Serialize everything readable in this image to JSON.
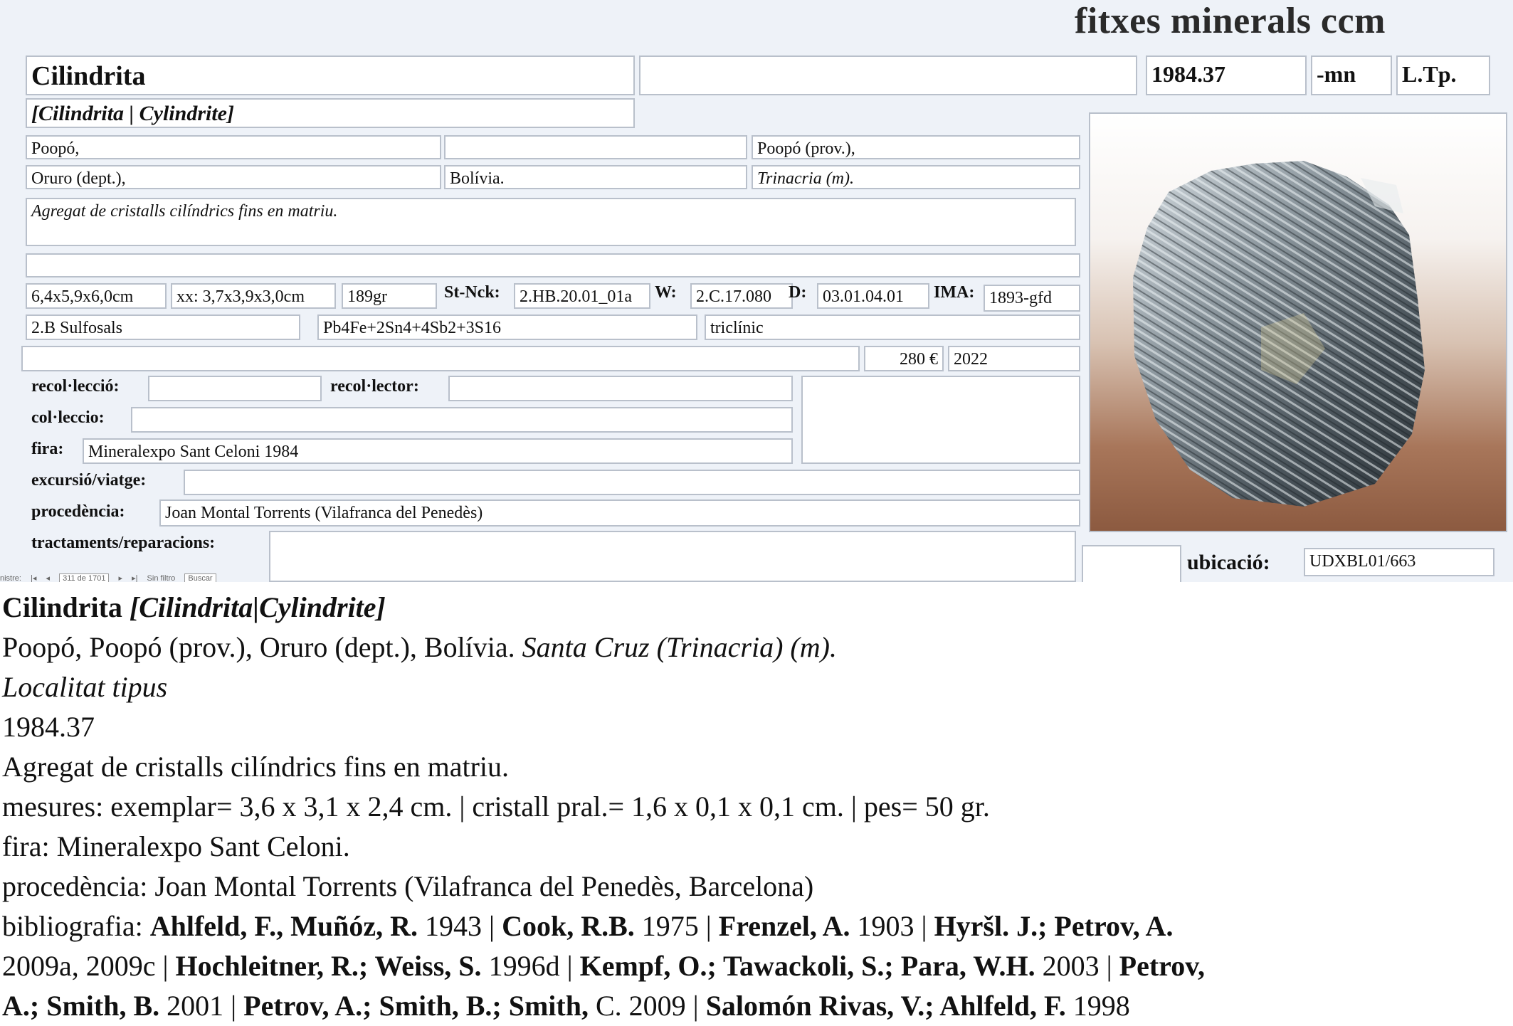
{
  "form": {
    "app_title": "fitxes minerals ccm",
    "name": "Cilindrita",
    "name_extra": "",
    "catalog_number": "1984.37",
    "suffix": "-mn",
    "type_locality_flag": "L.Tp.",
    "synonyms": "[Cilindrita | Cylindrite]",
    "locality_1": "Poopó,",
    "locality_2": "",
    "locality_3": "Poopó (prov.),",
    "locality_4": "Oruro (dept.),",
    "locality_5": "Bolívia.",
    "locality_6": "Trinacria (m).",
    "description": "Agregat de cristalls cilíndrics fins en matriu.",
    "notes": "",
    "size": "6,4x5,9x6,0cm",
    "crystal_size": "xx: 3,7x3,9x3,0cm",
    "weight": "189gr",
    "strunz_label": "St-Nck:",
    "strunz_value": "2.HB.20.01_01a",
    "w_label": "W:",
    "w_value": "2.C.17.080",
    "d_label": "D:",
    "d_value": "03.01.04.01",
    "ima_label": "IMA:",
    "ima_value": "1893-gfd",
    "class": "2.B Sulfosals",
    "formula": "Pb4Fe+2Sn4+4Sb2+3S16",
    "crystal_system": "triclínic",
    "blank_row": "",
    "price": "280 €",
    "year": "2022",
    "recoleccio_label": "recol·lecció:",
    "recoleccio_value": "",
    "recolector_label": "recol·lector:",
    "recolector_value": "",
    "coleccio_label": "col·leccio:",
    "coleccio_value": "",
    "fira_label": "fira:",
    "fira_value": "Mineralexpo Sant Celoni 1984",
    "excursio_label": "excursió/viatge:",
    "excursio_value": "",
    "procedencia_label": "procedència:",
    "procedencia_value": "Joan Montal Torrents (Vilafranca del Penedès)",
    "tractaments_label": "tractaments/reparacions:",
    "tractaments_value": "",
    "ubicacio_label": "ubicació:",
    "ubicacio_value": "UDXBL01/663"
  },
  "navigator": {
    "record_label": "nistre:",
    "record_position": "311 de 1701",
    "filter_label": "Sin filtro",
    "search_label": "Buscar"
  },
  "text": {
    "name": "Cilindrita",
    "synonyms": "[Cilindrita|Cylindrite]",
    "locality": "Poopó, Poopó (prov.), Oruro (dept.), Bolívia.",
    "mine": "Santa Cruz (Trinacria) (m).",
    "type_locality": "Localitat tipus",
    "catalog_number": "1984.37",
    "description": "Agregat de cristalls cilíndrics fins en matriu.",
    "measures": "mesures: exemplar= 3,6 x 3,1 x 2,4 cm. | cristall pral.= 1,6 x 0,1 x 0,1 cm. | pes= 50 gr.",
    "fair": "fira: Mineralexpo Sant Celoni.",
    "provenance": "procedència: Joan Montal Torrents (Vilafranca del Penedès, Barcelona)",
    "biblio_label": "bibliografia:",
    "biblio": [
      {
        "a": "Ahlfeld, F., Muñóz, R.",
        "y": "1943"
      },
      {
        "a": "Cook, R.B.",
        "y": "1975"
      },
      {
        "a": "Frenzel, A.",
        "y": "1903"
      },
      {
        "a": "Hyršl. J.; Petrov, A.",
        "y": "2009a, 2009c"
      },
      {
        "a": "Hochleitner, R.; Weiss, S.",
        "y": "1996d"
      },
      {
        "a": "Kempf, O.; Tawackoli, S.; Para, W.H.",
        "y": "2003"
      },
      {
        "a": "Petrov, A.; Smith, B.",
        "y": "2001"
      },
      {
        "a": "Petrov, A.; Smith, B.; Smith,",
        "y": "C. 2009"
      },
      {
        "a": "Salomón Rivas, V.; Ahlfeld, F.",
        "y": "1998"
      }
    ],
    "sep": " | "
  }
}
